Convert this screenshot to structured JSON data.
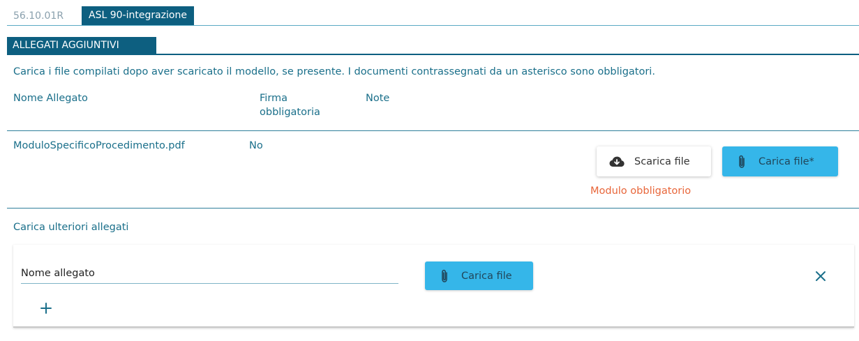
{
  "tabs": {
    "code": "56.10.01R",
    "active": "ASL 90-integrazione"
  },
  "section": {
    "title": "ALLEGATI AGGIUNTIVI",
    "intro": "Carica i file compilati dopo aver scaricato il modello, se presente. I documenti contrassegnati da un asterisco sono obbligatori."
  },
  "table": {
    "headers": {
      "name": "Nome Allegato",
      "firma_line1": "Firma",
      "firma_line2": "obbligatoria",
      "note": "Note"
    },
    "rows": [
      {
        "name": "ModuloSpecificoProcedimento.pdf",
        "firma": "No",
        "download_label": "Scarica file",
        "upload_label": "Carica file*",
        "error": "Modulo obbligatorio"
      }
    ]
  },
  "additional": {
    "title": "Carica ulteriori allegati",
    "name_placeholder": "Nome allegato",
    "upload_label": "Carica file"
  },
  "colors": {
    "primary": "#0d5f80",
    "accent": "#35b6e9",
    "error": "#e8663a"
  },
  "icons": [
    "cloud-download-icon",
    "paperclip-icon",
    "close-icon",
    "plus-icon"
  ]
}
